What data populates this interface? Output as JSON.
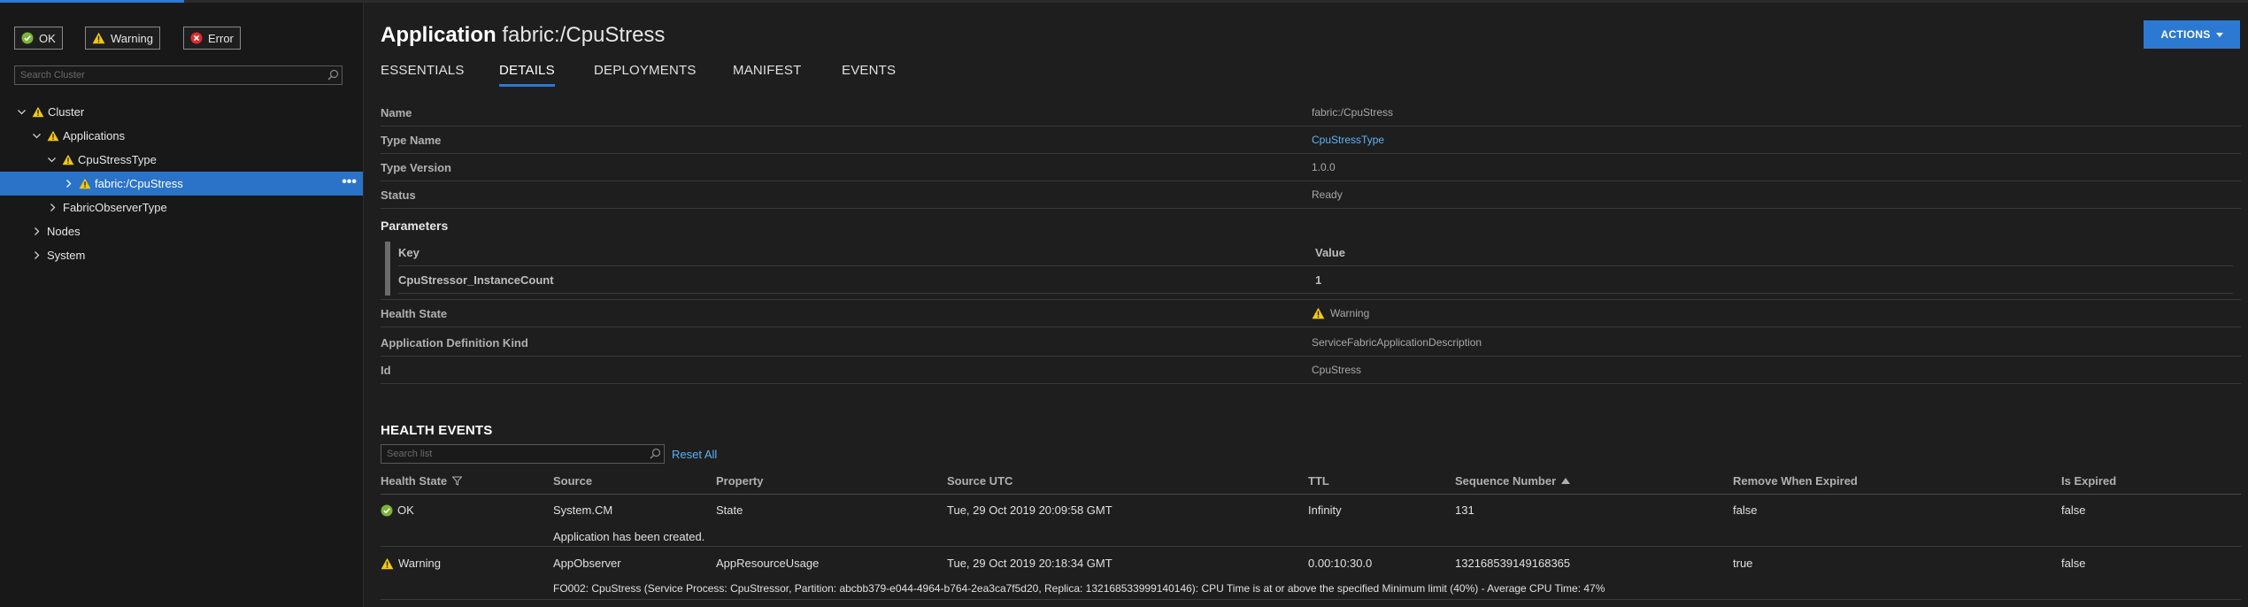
{
  "sidebar": {
    "filters": [
      {
        "label": "OK",
        "icon": "check-circle-icon"
      },
      {
        "label": "Warning",
        "icon": "warning-icon"
      },
      {
        "label": "Error",
        "icon": "error-circle-icon"
      }
    ],
    "search_placeholder": "Search Cluster",
    "tree": [
      {
        "label": "Cluster",
        "expanded": true,
        "status": "warning"
      },
      {
        "label": "Applications",
        "expanded": true,
        "status": "warning"
      },
      {
        "label": "CpuStressType",
        "expanded": true,
        "status": "warning"
      },
      {
        "label": "fabric:/CpuStress",
        "expanded": false,
        "status": "warning",
        "selected": true
      },
      {
        "label": "FabricObserverType",
        "expanded": false
      },
      {
        "label": "Nodes",
        "expanded": false
      },
      {
        "label": "System",
        "expanded": false
      }
    ],
    "more_label": "•••"
  },
  "header": {
    "title_prefix": "Application",
    "title_name": "fabric:/CpuStress",
    "actions_label": "ACTIONS"
  },
  "tabs": [
    {
      "label": "ESSENTIALS",
      "active": false
    },
    {
      "label": "DETAILS",
      "active": true
    },
    {
      "label": "DEPLOYMENTS",
      "active": false
    },
    {
      "label": "MANIFEST",
      "active": false
    },
    {
      "label": "EVENTS",
      "active": false
    }
  ],
  "details": {
    "name": {
      "label": "Name",
      "value": "fabric:/CpuStress"
    },
    "type_name": {
      "label": "Type Name",
      "value": "CpuStressType"
    },
    "type_version": {
      "label": "Type Version",
      "value": "1.0.0"
    },
    "status": {
      "label": "Status",
      "value": "Ready"
    },
    "parameters": {
      "heading": "Parameters",
      "key_header": "Key",
      "value_header": "Value",
      "rows": [
        {
          "key": "CpuStressor_InstanceCount",
          "value": "1"
        }
      ]
    },
    "health_state": {
      "label": "Health State",
      "value": "Warning"
    },
    "definition_kind": {
      "label": "Application Definition Kind",
      "value": "ServiceFabricApplicationDescription"
    },
    "id": {
      "label": "Id",
      "value": "CpuStress"
    }
  },
  "health_events": {
    "title": "HEALTH EVENTS",
    "search_placeholder": "Search list",
    "reset_label": "Reset All",
    "columns": [
      "Health State",
      "Source",
      "Property",
      "Source UTC",
      "TTL",
      "Sequence Number",
      "Remove When Expired",
      "Is Expired"
    ],
    "rows": [
      {
        "health_state": "OK",
        "source": "System.CM",
        "property": "State",
        "source_utc": "Tue, 29 Oct 2019 20:09:58 GMT",
        "ttl": "Infinity",
        "sequence_number": "131",
        "remove_when_expired": "false",
        "is_expired": "false",
        "description": "Application has been created."
      },
      {
        "health_state": "Warning",
        "source": "AppObserver",
        "property": "AppResourceUsage",
        "source_utc": "Tue, 29 Oct 2019 20:18:34 GMT",
        "ttl": "0.00:10:30.0",
        "sequence_number": "132168539149168365",
        "remove_when_expired": "true",
        "is_expired": "false",
        "description": "FO002: CpuStress (Service Process: CpuStressor, Partition: abcbb379-e044-4964-b764-2ea3ca7f5d20, Replica: 132168533999140146): CPU Time is at or above the specified Minimum limit (40%) - Average CPU Time: 47%"
      }
    ]
  },
  "colors": {
    "accent": "#2b79d1",
    "link": "#5db2f5",
    "ok": "#7cb43a",
    "warning": "#f2c811",
    "error": "#e02c2c"
  }
}
